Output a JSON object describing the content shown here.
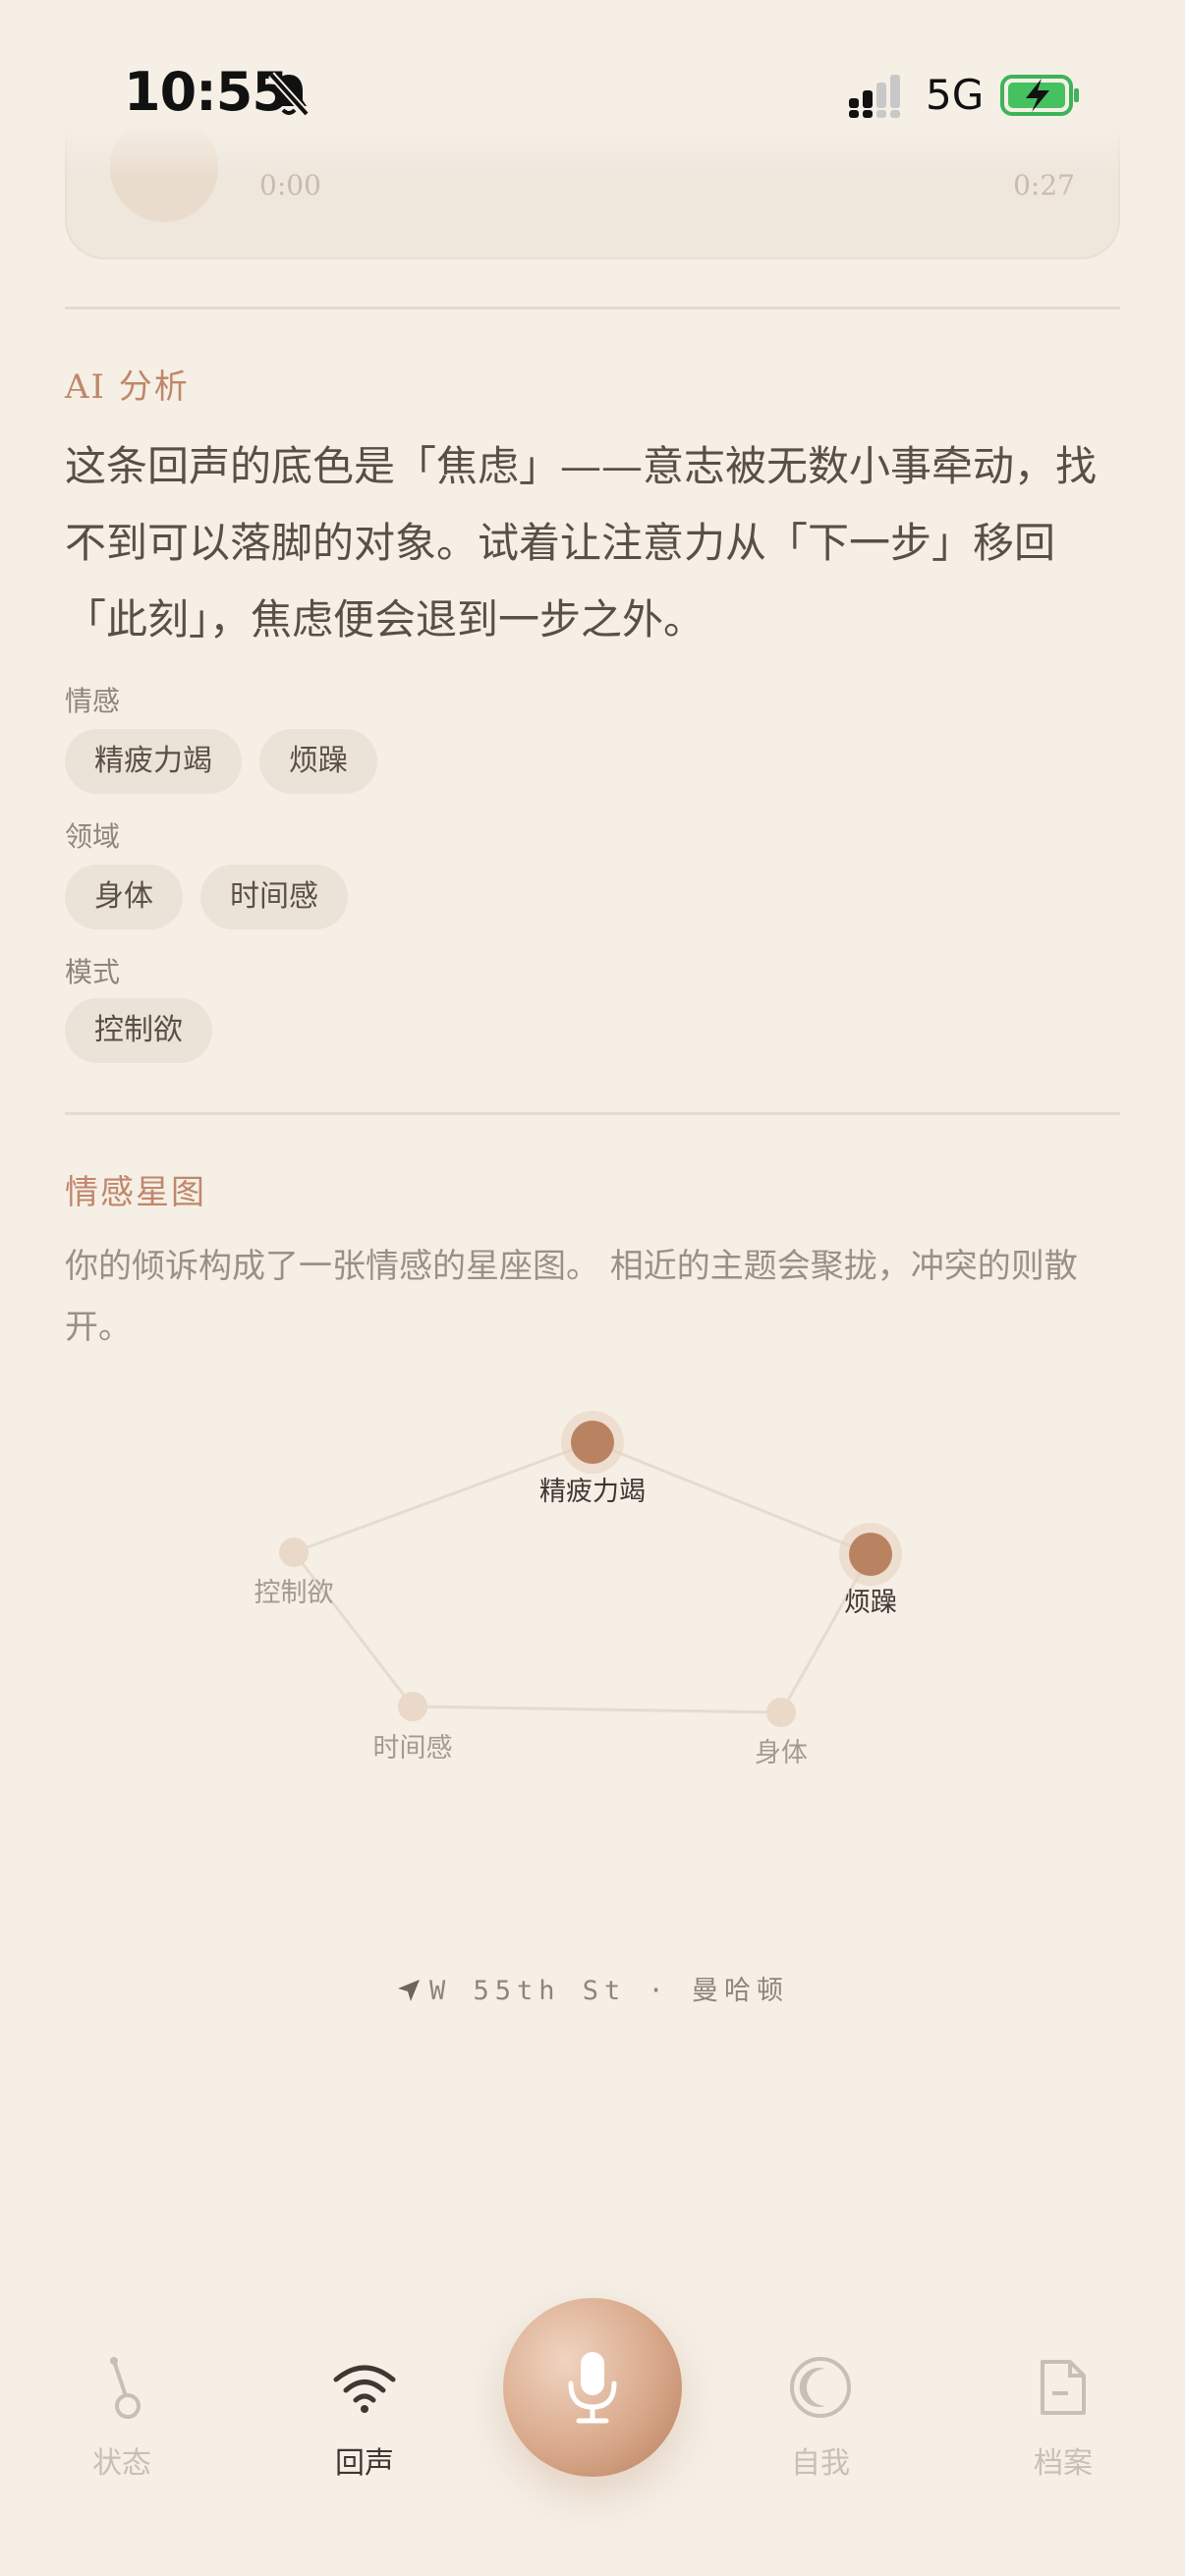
{
  "status_bar": {
    "time": "10:55",
    "network": "5G"
  },
  "player": {
    "current": "0:00",
    "duration": "0:27"
  },
  "analysis": {
    "title": "AI 分析",
    "text": "这条回声的底色是「焦虑」——意志被无数小事牵动，找不到可以落脚的对象。试着让注意力从「下一步」移回「此刻」，焦虑便会退到一步之外。",
    "groups": [
      {
        "label": "情感",
        "tags": [
          "精疲力竭",
          "烦躁"
        ]
      },
      {
        "label": "领域",
        "tags": [
          "身体",
          "时间感"
        ]
      },
      {
        "label": "模式",
        "tags": [
          "控制欲"
        ]
      }
    ]
  },
  "starmap": {
    "title": "情感星图",
    "description": "你的倾诉构成了一张情感的星座图。 相近的主题会聚拢，冲突的则散开。",
    "nodes": [
      {
        "label": "精疲力竭",
        "strength": "strong"
      },
      {
        "label": "烦躁",
        "strength": "strong"
      },
      {
        "label": "身体",
        "strength": "weak"
      },
      {
        "label": "时间感",
        "strength": "weak"
      },
      {
        "label": "控制欲",
        "strength": "weak"
      }
    ]
  },
  "location": {
    "text": "W 55th St · 曼哈顿",
    "icon": "location-arrow-icon"
  },
  "tabbar": {
    "tabs": [
      {
        "label": "状态",
        "icon": "pendulum-icon"
      },
      {
        "label": "回声",
        "icon": "wifi-signal-icon",
        "active": true
      },
      {
        "label": "自我",
        "icon": "crescent-moon-icon"
      },
      {
        "label": "档案",
        "icon": "document-icon"
      }
    ],
    "record_icon": "microphone-icon"
  }
}
